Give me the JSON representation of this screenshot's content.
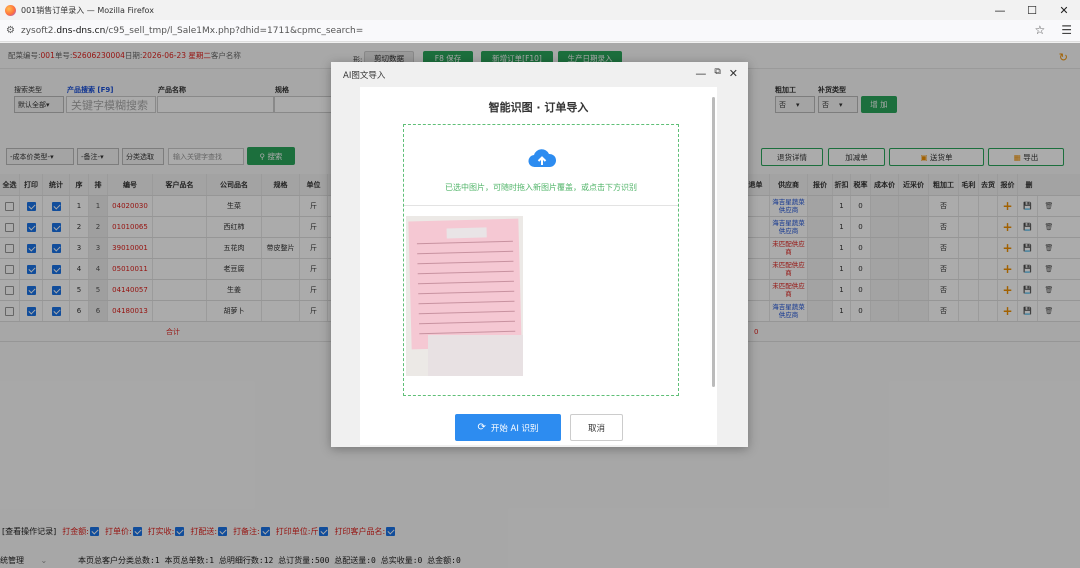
{
  "window": {
    "title": "001销售订单录入 — Mozilla Firefox"
  },
  "url": {
    "prefix": "zysoft2.",
    "domain": "dns-dns.cn",
    "path": "/c95_sell_tmp/l_Sale1Mx.php?dhid=1711&cpmc_search="
  },
  "info": {
    "label1": "配菜编号:",
    "val1": "001",
    "label2": "单号:",
    "val2": "S2606230004",
    "label3": "日期:",
    "val3": "2026-06-23 星期二",
    "label4": "客户名称"
  },
  "toolbar": {
    "cut_suffix": "形:",
    "cut": "剪切数据",
    "save": "F8 保存",
    "new_order": "新增订单[F10]",
    "gen_date": "生产日期录入"
  },
  "search": {
    "type_label": "搜索类型",
    "type_value": "默认全部",
    "product_search_label": "产品搜索 [F9]",
    "product_search_placeholder": "关键字模糊搜索",
    "product_name_label": "产品名称",
    "spec_label": "规格",
    "processing_label": "粗加工",
    "processing_value": "否",
    "supplement_label": "补货类型",
    "supplement_value": "否",
    "add": "增 加"
  },
  "filters": {
    "cost_type": "-成本价类型-",
    "note": "-备注-",
    "category": "分类选取",
    "keyword_placeholder": "输入关键字查找",
    "search": "搜索"
  },
  "actions": {
    "return": "退货详情",
    "add_reduce": "加减单",
    "delivery": "送货单",
    "export": "导出"
  },
  "table": {
    "headers_left": [
      "全选",
      "打印",
      "统计",
      "序",
      "排",
      "编号",
      "客户品名",
      "公司品名",
      "规格",
      "单位"
    ],
    "headers_right": [
      "退单",
      "供应商",
      "报价",
      "折扣",
      "税率",
      "成本价",
      "近采价",
      "粗加工",
      "毛利",
      "去货",
      "报价",
      "删"
    ],
    "rows": [
      {
        "seq": "1",
        "rank": "1",
        "code": "04020030",
        "company_name": "生菜",
        "spec": "",
        "unit": "斤",
        "supplier": "海吉星蔬菜供应商",
        "supplier_status": "ok",
        "discount": "1",
        "tax": "0",
        "rough": "否"
      },
      {
        "seq": "2",
        "rank": "2",
        "code": "01010065",
        "company_name": "西红柿",
        "spec": "",
        "unit": "斤",
        "supplier": "海吉星蔬菜供应商",
        "supplier_status": "ok",
        "discount": "1",
        "tax": "0",
        "rough": "否"
      },
      {
        "seq": "3",
        "rank": "3",
        "code": "39010001",
        "company_name": "五花肉",
        "spec": "带皮整片",
        "unit": "斤",
        "supplier": "未匹配供应商",
        "supplier_status": "none",
        "discount": "1",
        "tax": "0",
        "rough": "否"
      },
      {
        "seq": "4",
        "rank": "4",
        "code": "05010011",
        "company_name": "老豆腐",
        "spec": "",
        "unit": "斤",
        "supplier": "未匹配供应商",
        "supplier_status": "none",
        "discount": "1",
        "tax": "0",
        "rough": "否"
      },
      {
        "seq": "5",
        "rank": "5",
        "code": "04140057",
        "company_name": "生姜",
        "spec": "",
        "unit": "斤",
        "supplier": "未匹配供应商",
        "supplier_status": "none",
        "discount": "1",
        "tax": "0",
        "rough": "否"
      },
      {
        "seq": "6",
        "rank": "6",
        "code": "04180013",
        "company_name": "胡萝卜",
        "spec": "",
        "unit": "斤",
        "supplier": "海吉星蔬菜供应商",
        "supplier_status": "ok",
        "discount": "1",
        "tax": "0",
        "rough": "否"
      }
    ],
    "total_label": "合计",
    "total_value": "0"
  },
  "bottom": {
    "log": "[查看操作记录]",
    "opts": [
      "打金额:",
      "打单价:",
      "打实收:",
      "打配送:",
      "打备注:",
      "打印单位:斤",
      "打印客户品名:"
    ]
  },
  "status": {
    "left": "统管理",
    "text": "本页总客户分类总数:1  本页总单数:1  总明细行数:12  总订货量:500  总配送量:0  总实收量:0  总金额:0"
  },
  "modal": {
    "title": "AI图文导入",
    "heading": "智能识图 · 订单导入",
    "drop_text": "已选中图片，可随时拖入新图片覆盖，或点击下方识别",
    "start": "开始 AI 识别",
    "cancel": "取消"
  },
  "colors": {
    "green": "#2aa65c",
    "blue": "#2d8cf0",
    "red": "#e0201c"
  }
}
